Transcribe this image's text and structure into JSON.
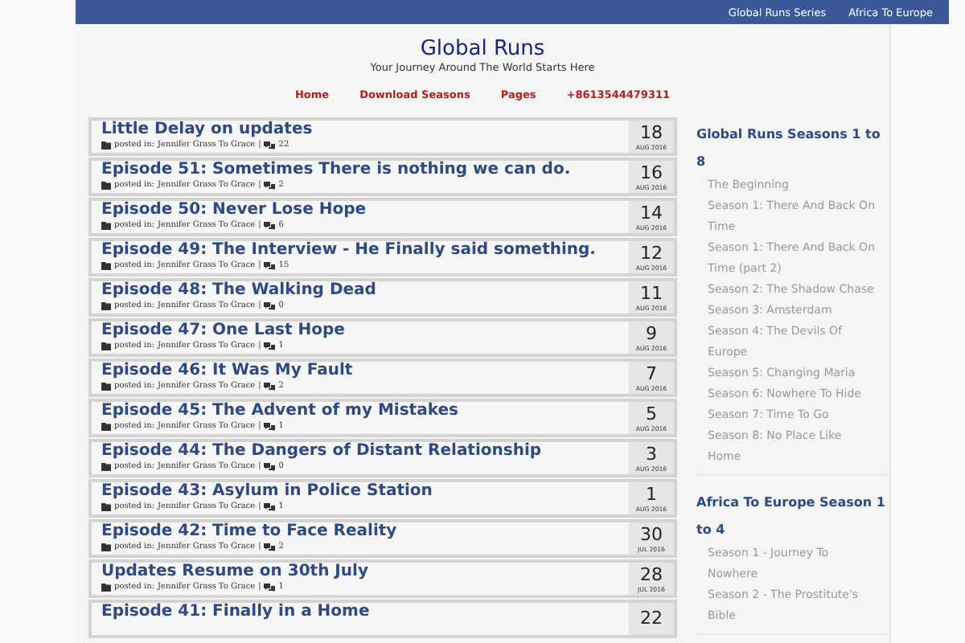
{
  "top_menu": [
    "Global Runs Series",
    "Africa To Europe"
  ],
  "site": {
    "title": "Global Runs",
    "tagline": "Your Journey Around The World Starts Here"
  },
  "main_menu": [
    "Home",
    "Download Seasons",
    "Pages",
    "+8613544479311"
  ],
  "posts": [
    {
      "title": "Little Delay on updates",
      "meta": {
        "label": "posted in:",
        "categories": "Jennifer  Grass To Grace",
        "separator": "|",
        "comments": "22"
      },
      "day": "18",
      "month": "AUG 2016"
    },
    {
      "title": "Episode 51: Sometimes There is nothing we can do.",
      "meta": {
        "label": "posted in:",
        "categories": "Jennifer  Grass To Grace",
        "separator": "|",
        "comments": "2"
      },
      "day": "16",
      "month": "AUG 2016"
    },
    {
      "title": "Episode 50: Never Lose Hope",
      "meta": {
        "label": "posted in:",
        "categories": "Jennifer  Grass To Grace",
        "separator": "|",
        "comments": "6"
      },
      "day": "14",
      "month": "AUG 2016"
    },
    {
      "title": "Episode 49: The Interview - He Finally said something.",
      "meta": {
        "label": "posted in:",
        "categories": "Jennifer  Grass To Grace",
        "separator": "|",
        "comments": "15"
      },
      "day": "12",
      "month": "AUG 2016"
    },
    {
      "title": "Episode 48: The Walking Dead",
      "meta": {
        "label": "posted in:",
        "categories": "Jennifer  Grass To Grace",
        "separator": "|",
        "comments": "0"
      },
      "day": "11",
      "month": "AUG 2016"
    },
    {
      "title": "Episode 47: One Last Hope",
      "meta": {
        "label": "posted in:",
        "categories": "Jennifer  Grass To Grace",
        "separator": "|",
        "comments": "1"
      },
      "day": "9",
      "month": "AUG 2016"
    },
    {
      "title": "Episode 46: It Was My Fault",
      "meta": {
        "label": "posted in:",
        "categories": "Jennifer  Grass To Grace",
        "separator": "|",
        "comments": "2"
      },
      "day": "7",
      "month": "AUG 2016"
    },
    {
      "title": "Episode 45: The Advent of my Mistakes",
      "meta": {
        "label": "posted in:",
        "categories": "Jennifer  Grass To Grace",
        "separator": "|",
        "comments": "1"
      },
      "day": "5",
      "month": "AUG 2016"
    },
    {
      "title": "Episode 44: The Dangers of Distant Relationship",
      "meta": {
        "label": "posted in:",
        "categories": "Jennifer  Grass To Grace",
        "separator": "|",
        "comments": "0"
      },
      "day": "3",
      "month": "AUG 2016"
    },
    {
      "title": "Episode 43: Asylum in Police Station",
      "meta": {
        "label": "posted in:",
        "categories": "Jennifer  Grass To Grace",
        "separator": "|",
        "comments": "1"
      },
      "day": "1",
      "month": "AUG 2016"
    },
    {
      "title": "Episode 42: Time to Face Reality",
      "meta": {
        "label": "posted in:",
        "categories": "Jennifer  Grass To Grace",
        "separator": "|",
        "comments": "2"
      },
      "day": "30",
      "month": "JUL 2016"
    },
    {
      "title": "Updates Resume on 30th July",
      "meta": {
        "label": "posted in:",
        "categories": "Jennifer  Grass To Grace",
        "separator": "|",
        "comments": "1"
      },
      "day": "28",
      "month": "JUL 2016"
    },
    {
      "title": "Episode 41: Finally in a Home",
      "day": "22"
    }
  ],
  "sidebar": [
    {
      "heading": "Global Runs Seasons 1 to 8",
      "items": [
        "The Beginning",
        "Season 1: There And Back On Time",
        "Season 1: There And Back On Time (part 2)",
        "Season 2: The Shadow Chase",
        "Season 3: Amsterdam",
        "Season 4: The Devils Of Europe",
        "Season 5: Changing Maria",
        "Season 6: Nowhere To Hide",
        "Season 7: Time To Go",
        "Season 8: No Place Like Home"
      ]
    },
    {
      "heading": "Africa To Europe Season 1 to 4",
      "items": [
        "Season 1 - Journey To Nowhere",
        "Season 2 - The Prostitute's Bible"
      ]
    }
  ]
}
